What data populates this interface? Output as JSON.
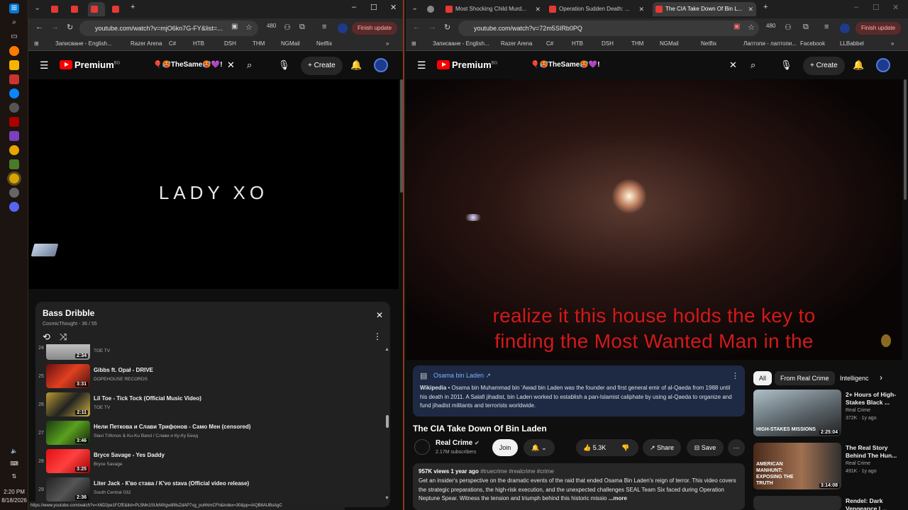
{
  "taskbar": {
    "time": "2:20 PM",
    "date": "8/18/2026"
  },
  "left": {
    "address": "youtube.com/watch?v=mjO6kn7G-FY&list=...",
    "finish_update": "Finish update",
    "bookmarks": [
      "Записване - English...",
      "Razer Arena",
      "C#",
      "НТВ",
      "DSH",
      "THM",
      "NGMail",
      "Netflix"
    ],
    "yt": {
      "logo": "Premium",
      "logo_sup": "BG",
      "search": "🎈🥵TheSame🥵💜!",
      "create": "Create"
    },
    "video_text": "LADY XO",
    "playlist": {
      "title": "Bass Dribble",
      "subtitle": "CosmicThought - 36 / 55",
      "items": [
        {
          "num": "24",
          "title": "",
          "channel": "TOE TV",
          "dur": "2:34"
        },
        {
          "num": "25",
          "title": "Gibbs ft. Opał - DRIVE",
          "channel": "DOPEHOUSE RECORDS",
          "dur": "3:31"
        },
        {
          "num": "26",
          "title": "Lil Toe - Tick Tock (Official Music Video)",
          "channel": "TOE TV",
          "dur": "2:11"
        },
        {
          "num": "27",
          "title": "Нели Петкова и Слави Трифонов - Само Мен (censored)",
          "channel": "Slavi Trifonov & Ku-Ku Band / Слави и Ку-Ку Бенд",
          "dur": "3:46"
        },
        {
          "num": "28",
          "title": "Bryce Savage - Yes Daddy",
          "channel": "Bryce Savage",
          "dur": "3:25"
        },
        {
          "num": "29",
          "title": "Liter Jack - К'во става / K'vo stava (Official video release)",
          "channel": "South Central 032",
          "dur": "2:36"
        }
      ]
    },
    "status_url": "https://www.youtube.com/watch?v=X6D2pe1FCfE&list=PL5Mn1SUkMXgvdI9isZdAP7sg_puhNmCFh&index=30&pp=iAQB8AUBsAgC"
  },
  "right": {
    "tabs": [
      "Most Shocking Child Murd...",
      "Operation Sudden Death: ...",
      "The CIA Take Down Of Bin L..."
    ],
    "address": "youtube.com/watch?v=72m5SIRb0PQ",
    "finish_update": "Finish update",
    "bookmarks": [
      "Записване - English...",
      "Razer Arena",
      "C#",
      "НТВ",
      "DSH",
      "THM",
      "NGMail",
      "Netflix",
      "Лаптопи - лаптопи...",
      "Facebook",
      "LLBabbel"
    ],
    "yt": {
      "logo": "Premium",
      "logo_sup": "BG",
      "search": "🎈🥵TheSame🥵💜!",
      "create": "Create"
    },
    "captions": [
      "realize it this house holds the key to",
      "finding the Most Wanted Man in the"
    ],
    "wiki": {
      "link": "Osama bin Laden ↗",
      "source": "Wikipedia",
      "text": " • Osama bin Muhammad bin 'Awad bin Laden was the founder and first general emir of al-Qaeda from 1988 until his death in 2011. A Salafi jihadist, bin Laden worked to establish a pan-Islamist caliphate by using al-Qaeda to organize and fund jihadist militants and terrorists worldwide."
    },
    "video_title": "The CIA Take Down Of Bin Laden",
    "channel": {
      "name": "Real Crime",
      "subs": "2.17M subscribers",
      "join": "Join"
    },
    "actions": {
      "likes": "5.3K",
      "share": "Share",
      "save": "Save"
    },
    "desc": {
      "meta": "957K views  1 year ago",
      "tags": "#truecrime #realcrime #crime",
      "text": "Get an insider's perspective on the dramatic events of the raid that ended Osama Bin Laden's reign of terror. This video covers the strategic preparations, the high-risk execution, and the unexpected challenges SEAL Team Six faced during Operation Neptune Spear. Witness the tension and triumph behind this historic missio",
      "more": "...more"
    },
    "chips": [
      "All",
      "From Real Crime",
      "Intelligenc"
    ],
    "recs": [
      {
        "title": "2+ Hours of High-Stakes Black ...",
        "channel": "Real Crime",
        "meta": "372K · 1y ago",
        "dur": "2:25:04",
        "thumb": "HIGH-STAKES MISSIONS"
      },
      {
        "title": "The Real Story Behind The Hun...",
        "channel": "Real Crime",
        "meta": "491K · 1y ago",
        "dur": "3:14:08",
        "thumb": "AMERICAN MANHUNT: EXPOSING THE TRUTH"
      },
      {
        "title": "Rendel: Dark Vengeance | ...",
        "channel": "",
        "meta": "",
        "dur": "",
        "thumb": ""
      }
    ]
  }
}
